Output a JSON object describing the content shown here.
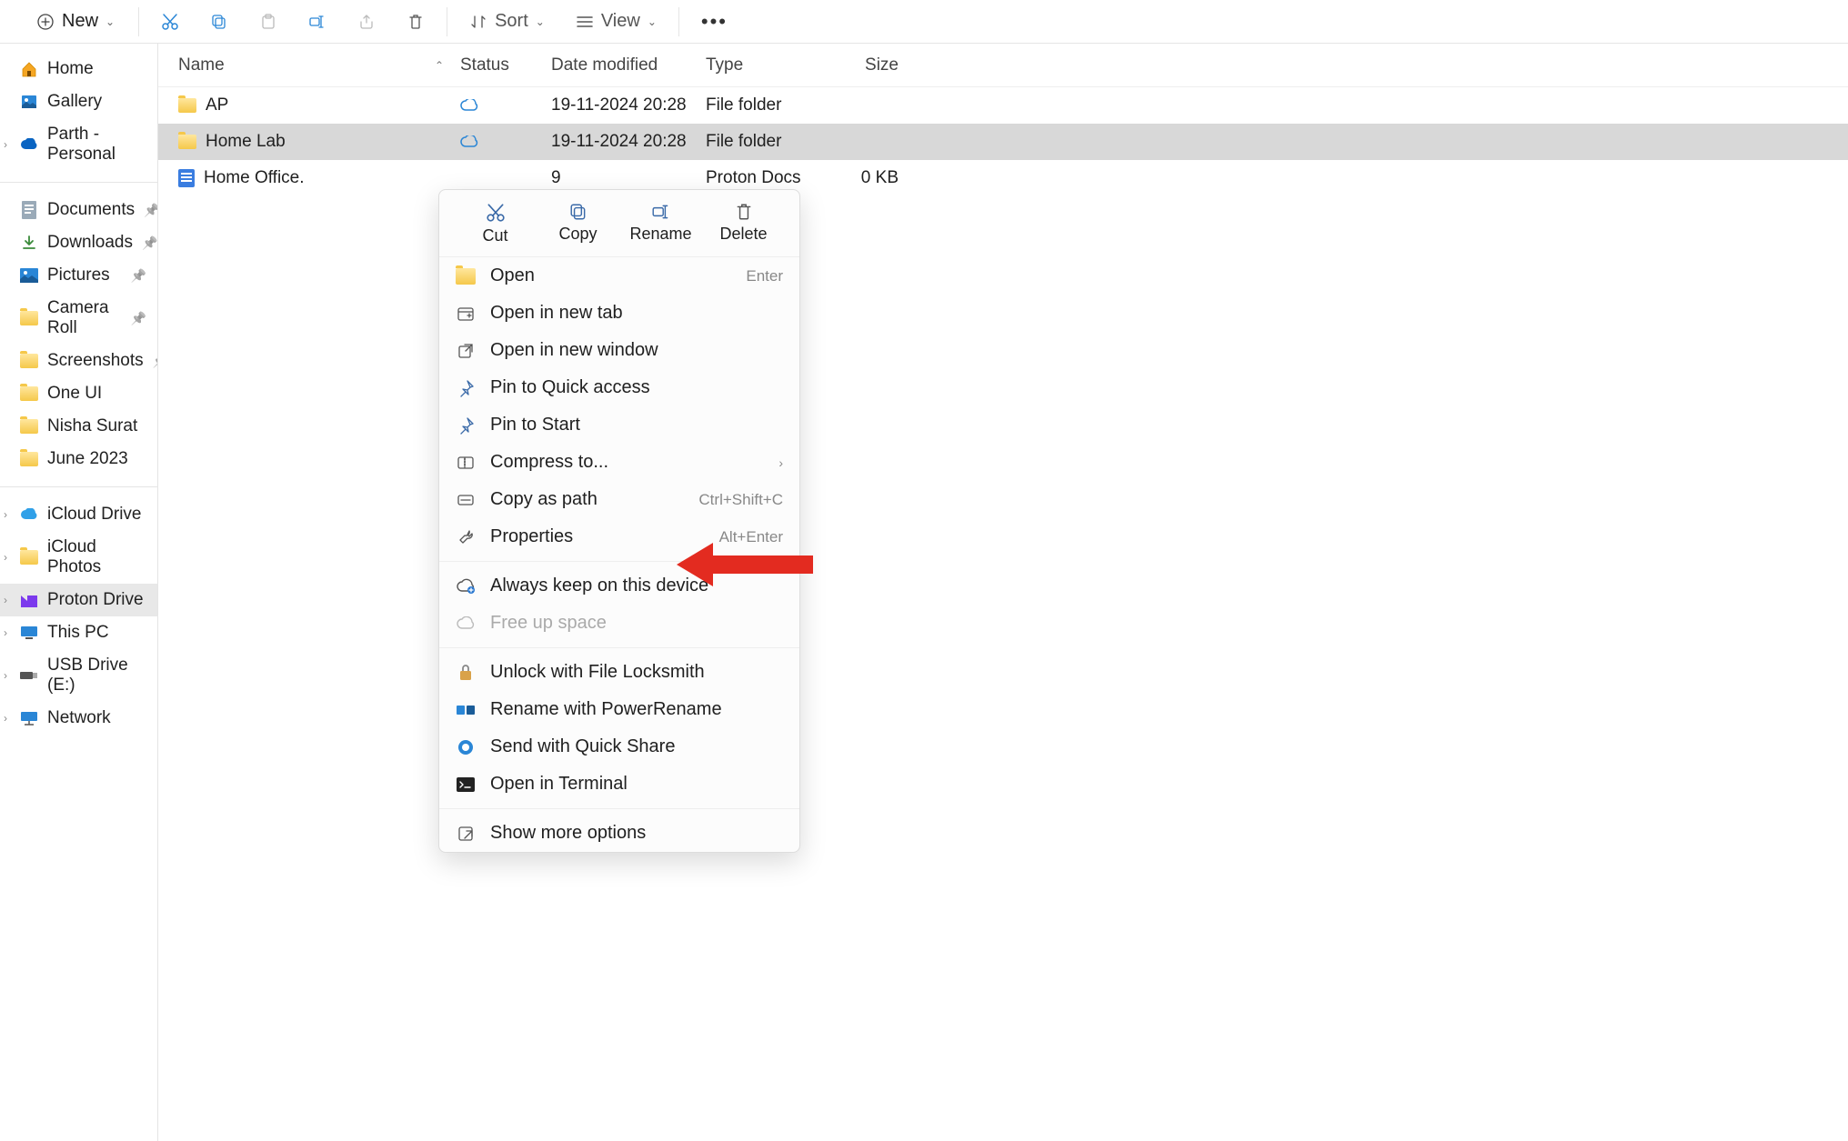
{
  "toolbar": {
    "new_label": "New",
    "sort_label": "Sort",
    "view_label": "View"
  },
  "sidebar": {
    "top": [
      {
        "label": "Home",
        "icon": "home"
      },
      {
        "label": "Gallery",
        "icon": "gallery"
      },
      {
        "label": "Parth - Personal",
        "icon": "onedrive",
        "chevron": true
      }
    ],
    "quick": [
      {
        "label": "Documents",
        "icon": "doc",
        "pin": true
      },
      {
        "label": "Downloads",
        "icon": "download",
        "pin": true
      },
      {
        "label": "Pictures",
        "icon": "pictures",
        "pin": true
      },
      {
        "label": "Camera Roll",
        "icon": "folder",
        "pin": true
      },
      {
        "label": "Screenshots",
        "icon": "folder",
        "pin": true
      },
      {
        "label": "One UI",
        "icon": "folder"
      },
      {
        "label": "Nisha Surat",
        "icon": "folder"
      },
      {
        "label": "June 2023",
        "icon": "folder"
      }
    ],
    "drives": [
      {
        "label": "iCloud Drive",
        "icon": "icloud",
        "chevron": true
      },
      {
        "label": "iCloud Photos",
        "icon": "folder",
        "chevron": true
      },
      {
        "label": "Proton Drive",
        "icon": "proton",
        "chevron": true,
        "active": true
      },
      {
        "label": "This PC",
        "icon": "pc",
        "chevron": true
      },
      {
        "label": "USB Drive (E:)",
        "icon": "usb",
        "chevron": true
      },
      {
        "label": "Network",
        "icon": "network",
        "chevron": true
      }
    ]
  },
  "columns": {
    "name": "Name",
    "status": "Status",
    "date": "Date modified",
    "type": "Type",
    "size": "Size"
  },
  "files": [
    {
      "name": "AP",
      "status": "cloud",
      "date": "19-11-2024 20:28",
      "type": "File folder",
      "size": "",
      "kind": "folder"
    },
    {
      "name": "Home Lab",
      "status": "cloud",
      "date": "19-11-2024 20:28",
      "type": "File folder",
      "size": "",
      "kind": "folder",
      "selected": true
    },
    {
      "name": "Home Office.",
      "status": "",
      "date": "9",
      "type": "Proton Docs",
      "size": "0 KB",
      "kind": "doc"
    }
  ],
  "context_menu": {
    "top": [
      {
        "label": "Cut",
        "icon": "cut"
      },
      {
        "label": "Copy",
        "icon": "copy"
      },
      {
        "label": "Rename",
        "icon": "rename"
      },
      {
        "label": "Delete",
        "icon": "delete"
      }
    ],
    "items": [
      {
        "label": "Open",
        "icon": "open-folder",
        "shortcut": "Enter"
      },
      {
        "label": "Open in new tab",
        "icon": "newtab"
      },
      {
        "label": "Open in new window",
        "icon": "newwin"
      },
      {
        "label": "Pin to Quick access",
        "icon": "pin"
      },
      {
        "label": "Pin to Start",
        "icon": "pin"
      },
      {
        "label": "Compress to...",
        "icon": "compress",
        "submenu": true
      },
      {
        "label": "Copy as path",
        "icon": "path",
        "shortcut": "Ctrl+Shift+C"
      },
      {
        "label": "Properties",
        "icon": "props",
        "shortcut": "Alt+Enter"
      },
      {
        "sep": true
      },
      {
        "label": "Always keep on this device",
        "icon": "keep"
      },
      {
        "label": "Free up space",
        "icon": "cloud",
        "disabled": true
      },
      {
        "sep": true
      },
      {
        "label": "Unlock with File Locksmith",
        "icon": "lock"
      },
      {
        "label": "Rename with PowerRename",
        "icon": "prename"
      },
      {
        "label": "Send with Quick Share",
        "icon": "qshare"
      },
      {
        "label": "Open in Terminal",
        "icon": "terminal"
      },
      {
        "sep": true
      },
      {
        "label": "Show more options",
        "icon": "more"
      }
    ]
  }
}
